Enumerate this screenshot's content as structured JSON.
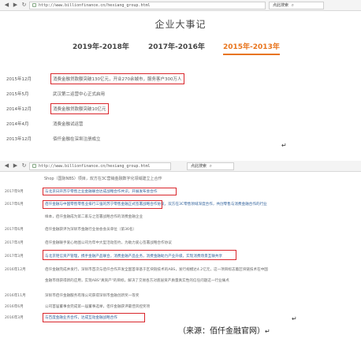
{
  "shot1": {
    "browser": {
      "back": "◀",
      "forward": "▶",
      "refresh": "↻",
      "url": "http://www.billionfinance.cn/hexiang_group.html",
      "search": "点此搜索"
    },
    "title": "企业大事记",
    "tabs": [
      "2019年-2018年",
      "2017年-2016年",
      "2015年-2013年"
    ],
    "active_tab": "2015年-2013年",
    "events": [
      {
        "date": "2015年12月",
        "text": "消费金融贷款额突破130亿元，开业270余城市，服务客户300万人",
        "highlighted": true
      },
      {
        "date": "2015年5月",
        "text": "武汉第二运营中心正式启用",
        "highlighted": false
      },
      {
        "date": "2014年12月",
        "text": "消费金融贷款额突破10亿元",
        "highlighted": true
      },
      {
        "date": "2014年4月",
        "text": "消费金融试运营",
        "highlighted": false
      },
      {
        "date": "2013年12月",
        "text": "佰仟金融在深圳注册成立",
        "highlighted": false
      }
    ],
    "return_mark": "↵"
  },
  "shot2": {
    "browser": {
      "back": "◀",
      "forward": "▶",
      "refresh": "↻",
      "url": "http://www.billionfinance.cn/hexiang_group.html",
      "search": "点此搜索"
    },
    "intro": "Shop（国际NBS）项目，双方在3C营销金融数字化领域建立上合作",
    "rows": [
      {
        "date": "2017年9月",
        "text": "与北京日开苏宁零售之业金融联合达成战略合作共识，开展发布会合作",
        "blue": true
      },
      {
        "date": "2017年6月",
        "text": "佰仟金融与中国零售零售业排行三强的苏宁零售金融正式签署战略合作协议，双方在3C零售领域深度合作，共创零售与消费金融合作的行业",
        "line2": "样本，佰仟金融成为第二家与之签署战略合作的消费金融企业",
        "blue": true
      },
      {
        "date": "2017年6月",
        "text": "佰仟金融获评为深圳市金融行业协会会员单位（第36名）",
        "blue": false
      },
      {
        "date": "2017年4月",
        "text": "佰仟金融联手爱心地图公司为年中大型活动签约，为助力爱心签署战略合作协议",
        "blue": false
      },
      {
        "date": "2017年3月",
        "text": "与北京钜信资产管理，携手金融产品联合，消费金融产品业务，消费金融助力产业升级，实现消费场景互联共享",
        "blue": true
      },
      {
        "date": "2016年12月",
        "text": "佰仟金融完成并发行，深圳市首次与佰仟合作开发全国首单基于区块链技术的ABS，发行规模达4.2亿元，这一项目标志着区块链技术在中国",
        "line2": "金融市场获得新的应用，实现ABS\"真资产\"的目标，解决了交易各方对底层资产质量真实性的信任问题这一行业痛点",
        "blue": false
      },
      {
        "date": "2016年11月",
        "text": "深圳市佰仟金融服务有限公司获得深圳市金融创新奖一等奖",
        "blue": false
      },
      {
        "date": "2016年6月",
        "text": "公司首届董事会完成第一届董事选举，佰仟金融获评最佳风控奖项",
        "blue": false
      },
      {
        "date": "2016年3月",
        "text": "与百度金融业务合作，达成互动金融战略合作",
        "blue": true
      }
    ],
    "return_mark": "↵"
  },
  "caption": "（来源：佰仟金融官网）",
  "caption_mark": "↵",
  "colors": {
    "highlight_box": "#d9262c",
    "active_tab": "#e8741c",
    "link_text": "#2d5f9a"
  }
}
